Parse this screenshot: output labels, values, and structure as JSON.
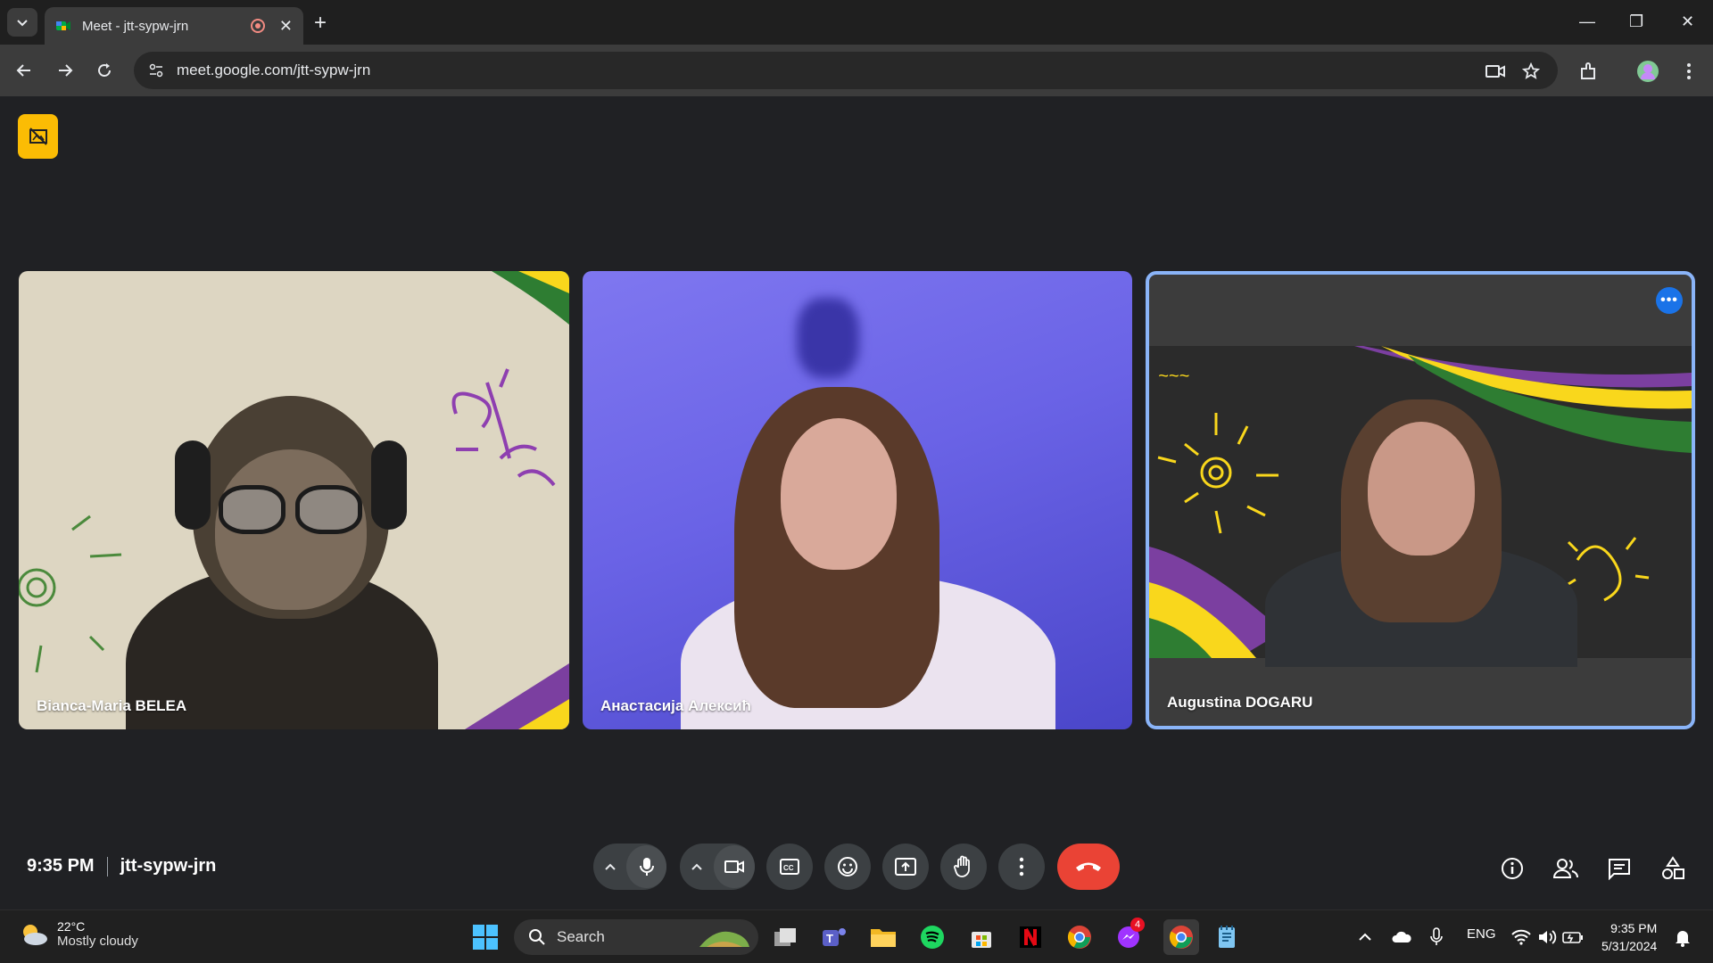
{
  "browser": {
    "tab_title": "Meet - jtt-sypw-jrn",
    "url": "meet.google.com/jtt-sypw-jrn"
  },
  "participants": [
    {
      "name": "Bianca-Maria BELEA"
    },
    {
      "name": "Анастасија Алексић"
    },
    {
      "name": "Augustina DOGARU"
    }
  ],
  "meeting": {
    "time": "9:35 PM",
    "code": "jtt-sypw-jrn",
    "people_count": "3"
  },
  "taskbar": {
    "temperature": "22°C",
    "weather": "Mostly cloudy",
    "search_label": "Search",
    "messenger_badge": "4",
    "language": "ENG",
    "time": "9:35 PM",
    "date": "5/31/2024"
  },
  "colors": {
    "accent": "#8ab4f8",
    "end_call": "#ea4335",
    "hide_button": "#fbbc04"
  }
}
